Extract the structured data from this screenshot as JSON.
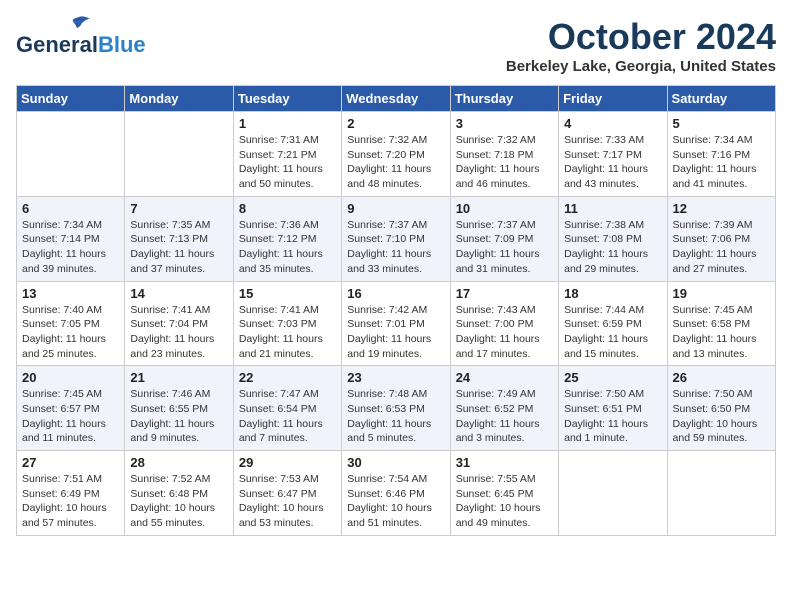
{
  "header": {
    "logo_line1": "General",
    "logo_line2": "Blue",
    "title": "October 2024",
    "subtitle": "Berkeley Lake, Georgia, United States"
  },
  "weekdays": [
    "Sunday",
    "Monday",
    "Tuesday",
    "Wednesday",
    "Thursday",
    "Friday",
    "Saturday"
  ],
  "weeks": [
    [
      {
        "day": null
      },
      {
        "day": null
      },
      {
        "day": "1",
        "sunrise": "7:31 AM",
        "sunset": "7:21 PM",
        "daylight": "11 hours and 50 minutes."
      },
      {
        "day": "2",
        "sunrise": "7:32 AM",
        "sunset": "7:20 PM",
        "daylight": "11 hours and 48 minutes."
      },
      {
        "day": "3",
        "sunrise": "7:32 AM",
        "sunset": "7:18 PM",
        "daylight": "11 hours and 46 minutes."
      },
      {
        "day": "4",
        "sunrise": "7:33 AM",
        "sunset": "7:17 PM",
        "daylight": "11 hours and 43 minutes."
      },
      {
        "day": "5",
        "sunrise": "7:34 AM",
        "sunset": "7:16 PM",
        "daylight": "11 hours and 41 minutes."
      }
    ],
    [
      {
        "day": "6",
        "sunrise": "7:34 AM",
        "sunset": "7:14 PM",
        "daylight": "11 hours and 39 minutes."
      },
      {
        "day": "7",
        "sunrise": "7:35 AM",
        "sunset": "7:13 PM",
        "daylight": "11 hours and 37 minutes."
      },
      {
        "day": "8",
        "sunrise": "7:36 AM",
        "sunset": "7:12 PM",
        "daylight": "11 hours and 35 minutes."
      },
      {
        "day": "9",
        "sunrise": "7:37 AM",
        "sunset": "7:10 PM",
        "daylight": "11 hours and 33 minutes."
      },
      {
        "day": "10",
        "sunrise": "7:37 AM",
        "sunset": "7:09 PM",
        "daylight": "11 hours and 31 minutes."
      },
      {
        "day": "11",
        "sunrise": "7:38 AM",
        "sunset": "7:08 PM",
        "daylight": "11 hours and 29 minutes."
      },
      {
        "day": "12",
        "sunrise": "7:39 AM",
        "sunset": "7:06 PM",
        "daylight": "11 hours and 27 minutes."
      }
    ],
    [
      {
        "day": "13",
        "sunrise": "7:40 AM",
        "sunset": "7:05 PM",
        "daylight": "11 hours and 25 minutes."
      },
      {
        "day": "14",
        "sunrise": "7:41 AM",
        "sunset": "7:04 PM",
        "daylight": "11 hours and 23 minutes."
      },
      {
        "day": "15",
        "sunrise": "7:41 AM",
        "sunset": "7:03 PM",
        "daylight": "11 hours and 21 minutes."
      },
      {
        "day": "16",
        "sunrise": "7:42 AM",
        "sunset": "7:01 PM",
        "daylight": "11 hours and 19 minutes."
      },
      {
        "day": "17",
        "sunrise": "7:43 AM",
        "sunset": "7:00 PM",
        "daylight": "11 hours and 17 minutes."
      },
      {
        "day": "18",
        "sunrise": "7:44 AM",
        "sunset": "6:59 PM",
        "daylight": "11 hours and 15 minutes."
      },
      {
        "day": "19",
        "sunrise": "7:45 AM",
        "sunset": "6:58 PM",
        "daylight": "11 hours and 13 minutes."
      }
    ],
    [
      {
        "day": "20",
        "sunrise": "7:45 AM",
        "sunset": "6:57 PM",
        "daylight": "11 hours and 11 minutes."
      },
      {
        "day": "21",
        "sunrise": "7:46 AM",
        "sunset": "6:55 PM",
        "daylight": "11 hours and 9 minutes."
      },
      {
        "day": "22",
        "sunrise": "7:47 AM",
        "sunset": "6:54 PM",
        "daylight": "11 hours and 7 minutes."
      },
      {
        "day": "23",
        "sunrise": "7:48 AM",
        "sunset": "6:53 PM",
        "daylight": "11 hours and 5 minutes."
      },
      {
        "day": "24",
        "sunrise": "7:49 AM",
        "sunset": "6:52 PM",
        "daylight": "11 hours and 3 minutes."
      },
      {
        "day": "25",
        "sunrise": "7:50 AM",
        "sunset": "6:51 PM",
        "daylight": "11 hours and 1 minute."
      },
      {
        "day": "26",
        "sunrise": "7:50 AM",
        "sunset": "6:50 PM",
        "daylight": "10 hours and 59 minutes."
      }
    ],
    [
      {
        "day": "27",
        "sunrise": "7:51 AM",
        "sunset": "6:49 PM",
        "daylight": "10 hours and 57 minutes."
      },
      {
        "day": "28",
        "sunrise": "7:52 AM",
        "sunset": "6:48 PM",
        "daylight": "10 hours and 55 minutes."
      },
      {
        "day": "29",
        "sunrise": "7:53 AM",
        "sunset": "6:47 PM",
        "daylight": "10 hours and 53 minutes."
      },
      {
        "day": "30",
        "sunrise": "7:54 AM",
        "sunset": "6:46 PM",
        "daylight": "10 hours and 51 minutes."
      },
      {
        "day": "31",
        "sunrise": "7:55 AM",
        "sunset": "6:45 PM",
        "daylight": "10 hours and 49 minutes."
      },
      {
        "day": null
      },
      {
        "day": null
      }
    ]
  ]
}
